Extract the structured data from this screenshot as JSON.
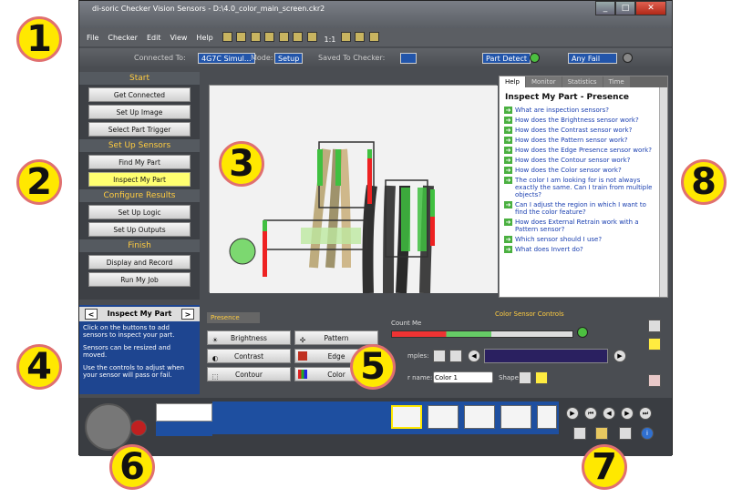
{
  "window": {
    "title": "di-soric Checker Vision Sensors - D:\\4.0_color_main_screen.ckr2"
  },
  "menu": [
    "File",
    "Checker",
    "Edit",
    "View",
    "Help"
  ],
  "zoom_label": "1:1",
  "status": {
    "connected_label": "Connected To:",
    "connected_value": "4G7C Simul...",
    "mode_label": "Mode:",
    "mode_value": "Setup",
    "saved_label": "Saved To Checker:",
    "part_detect": "Part Detect",
    "any_fail": "Any Fail"
  },
  "sidebar": {
    "sections": [
      {
        "num": "1",
        "title": "Start",
        "buttons": [
          "Get Connected",
          "Set Up Image",
          "Select Part Trigger"
        ]
      },
      {
        "num": "2",
        "title": "Set Up Sensors",
        "buttons": [
          "Find My Part",
          "Inspect My Part"
        ]
      },
      {
        "num": "3",
        "title": "Configure Results",
        "buttons": [
          "Set Up Logic",
          "Set Up Outputs"
        ]
      },
      {
        "num": "4",
        "title": "Finish",
        "buttons": [
          "Display and Record",
          "Run My Job"
        ]
      }
    ]
  },
  "help": {
    "tabs": [
      "Help",
      "Monitor",
      "Statistics",
      "Time"
    ],
    "title": "Inspect My Part - Presence",
    "links": [
      "What are inspection sensors?",
      "How does the Brightness sensor work?",
      "How does the Contrast sensor work?",
      "How does the Pattern sensor work?",
      "How does the Edge Presence sensor work?",
      "How does the Contour sensor work?",
      "How does the Color sensor work?",
      "The color I am looking for is not always exactly the same. Can I train from multiple objects?",
      "Can I adjust the region in which I want to find the color feature?",
      "How does External Retrain work with a Pattern sensor?",
      "Which sensor should I use?",
      "What does Invert do?"
    ]
  },
  "desc": {
    "title": "Inspect My Part",
    "prev": "<",
    "next": ">",
    "lines": [
      "Click on the buttons to add sensors to inspect your part.",
      "Sensors can be resized and moved.",
      "Use the controls to adjust when your sensor will pass or fail."
    ]
  },
  "sensors": {
    "tab": "Presence",
    "buttons": [
      "Brightness",
      "Pattern",
      "Contrast",
      "Edge",
      "Contour",
      "Color"
    ]
  },
  "color_controls": {
    "title": "Color Sensor Controls",
    "count_label": "Count Me",
    "samples_label": "mples:",
    "color_name_label": "r name:",
    "color_name_value": "Color 1",
    "shape_label": "Shape"
  },
  "callouts": [
    "1",
    "2",
    "3",
    "4",
    "5",
    "6",
    "7",
    "8"
  ]
}
